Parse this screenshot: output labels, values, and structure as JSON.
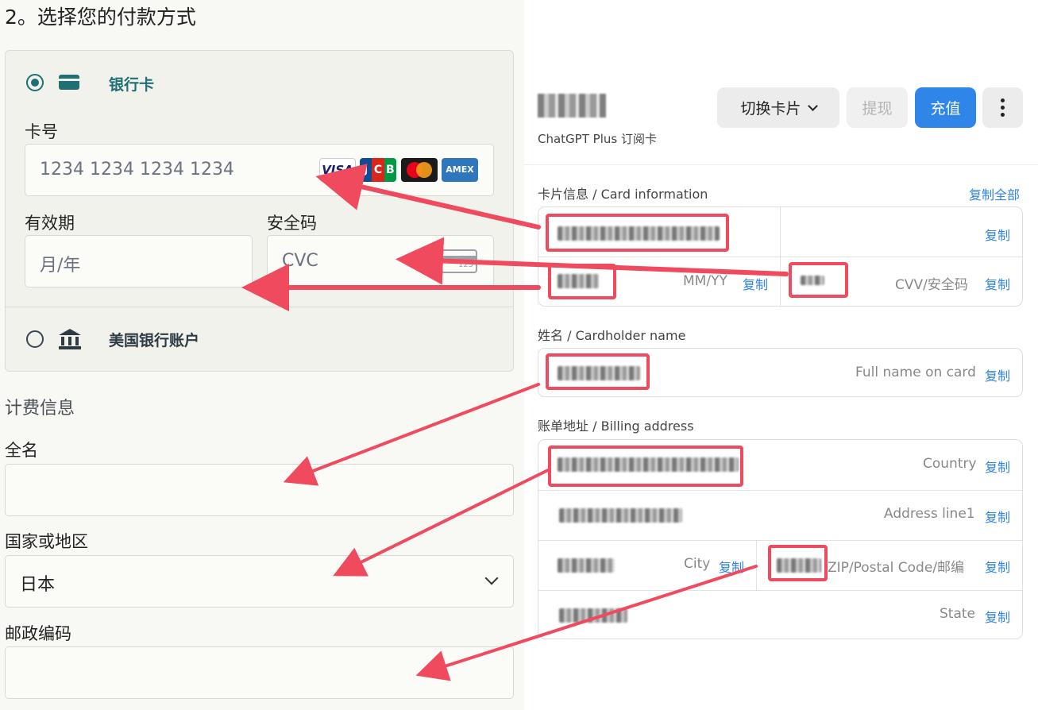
{
  "left": {
    "step_title": "2。选择您的付款方式",
    "payment_method": {
      "bank_card_label": "银行卡",
      "card_number_label": "卡号",
      "card_number_placeholder": "1234 1234 1234 1234",
      "brands": [
        "VISA",
        "JCB",
        "Mastercard",
        "AMEX"
      ],
      "expiry_label": "有效期",
      "expiry_placeholder": "月/年",
      "cvc_label": "安全码",
      "cvc_placeholder": "CVC",
      "cvc_icon_digits": "123",
      "us_bank_label": "美国银行账户"
    },
    "billing": {
      "heading": "计费信息",
      "full_name_label": "全名",
      "country_label": "国家或地区",
      "country_value": "日本",
      "postal_label": "邮政编码"
    }
  },
  "right": {
    "card_subtitle": "ChatGPT Plus 订阅卡",
    "buttons": {
      "switch_card": "切换卡片",
      "withdraw": "提现",
      "recharge": "充值"
    },
    "card_info": {
      "label": "卡片信息 / Card information",
      "copy_all": "复制全部",
      "expiry_placeholder": "MM/YY",
      "cvv_placeholder": "CVV/安全码"
    },
    "cardholder": {
      "label": "姓名 / Cardholder name",
      "placeholder": "Full name on card"
    },
    "billing_address": {
      "label": "账单地址 / Billing address",
      "country": "Country",
      "address_line1": "Address line1",
      "city": "City",
      "zip": "ZIP/Postal Code/邮编",
      "state": "State"
    },
    "copy_label": "复制"
  },
  "colors": {
    "accent_teal": "#1f6f75",
    "link_blue": "#2f86e8",
    "highlight_red": "#f04a5e"
  }
}
